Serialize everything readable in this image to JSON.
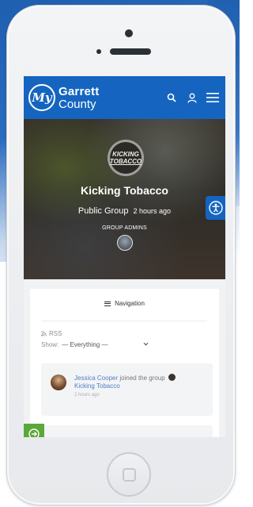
{
  "header": {
    "logo_mark": "My",
    "logo_line1": "Garrett",
    "logo_line2": "County",
    "icons": [
      "search-icon",
      "user-icon",
      "hamburger-menu-icon"
    ]
  },
  "group": {
    "avatar_line1": "KICKING",
    "avatar_line2": "TOBACCO",
    "title": "Kicking Tobacco",
    "type": "Public Group",
    "last_active": "2 hours ago",
    "admins_label": "GROUP ADMINS"
  },
  "navigation": {
    "label": "Navigation"
  },
  "feed": {
    "rss_label": "RSS",
    "show_label": "Show:",
    "filter_value": "— Everything —",
    "activity": {
      "user": "Jessica Cooper",
      "action": "joined the group",
      "group": "Kicking Tobacco",
      "time": "2 hours ago"
    }
  },
  "colors": {
    "brand_blue": "#1565c0",
    "link_blue": "#4f7fc2",
    "accessibility_green": "#5aa83a"
  }
}
